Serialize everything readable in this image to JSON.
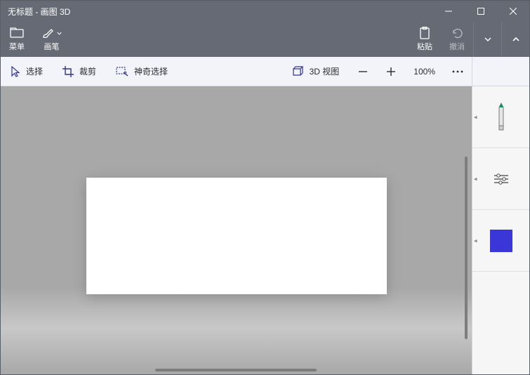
{
  "window": {
    "title": "无标题 - 画图 3D"
  },
  "commandbar": {
    "menu": "菜单",
    "brush": "画笔",
    "paste": "粘贴",
    "undo": "撤消"
  },
  "toolbar": {
    "select": "选择",
    "crop": "裁剪",
    "magic_select": "神奇选择",
    "view3d": "3D 视图",
    "zoom_level": "100%"
  },
  "colors": {
    "accent": "#3b36d8",
    "marker_tip": "#0f8f6a"
  }
}
